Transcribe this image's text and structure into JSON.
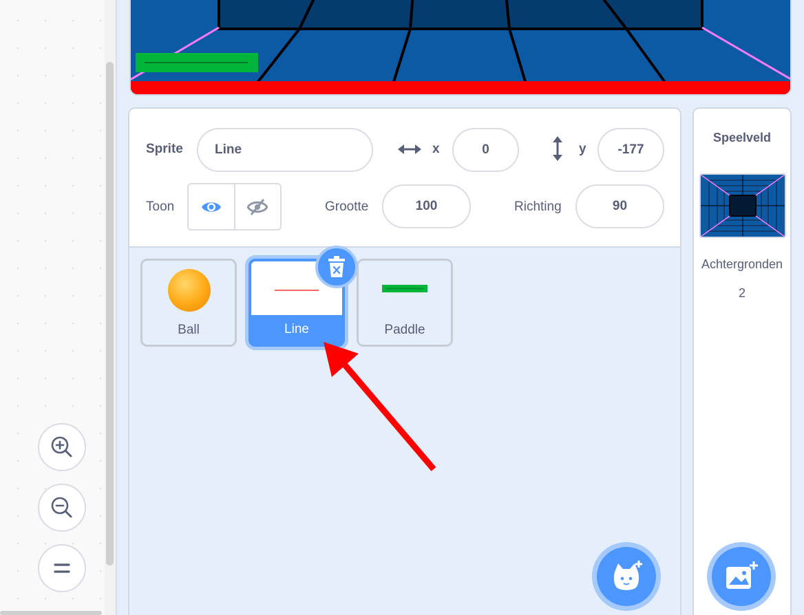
{
  "sprite_info": {
    "sprite_label": "Sprite",
    "sprite_name": "Line",
    "x_label": "x",
    "x_value": "0",
    "y_label": "y",
    "y_value": "-177",
    "show_label": "Toon",
    "size_label": "Grootte",
    "size_value": "100",
    "direction_label": "Richting",
    "direction_value": "90"
  },
  "sprites": [
    {
      "name": "Ball",
      "selected": false
    },
    {
      "name": "Line",
      "selected": true
    },
    {
      "name": "Paddle",
      "selected": false
    }
  ],
  "stage_panel": {
    "title": "Speelveld",
    "backdrops_label": "Achtergronden",
    "backdrops_count": "2"
  },
  "colors": {
    "accent": "#4c97ff",
    "accent_light": "#a6c9fb",
    "text": "#575e75",
    "annotation_arrow": "#ff0000",
    "stage_floor": "#0b5aa3",
    "paddle_green": "#00b53a"
  },
  "icons": {
    "zoom_in": "zoom-in-icon",
    "zoom_out": "zoom-out-icon",
    "zoom_reset": "zoom-reset-icon",
    "show": "eye-icon",
    "hide": "eye-slash-icon",
    "delete": "trash-icon",
    "add_sprite": "cat-plus-icon",
    "add_backdrop": "image-plus-icon"
  }
}
